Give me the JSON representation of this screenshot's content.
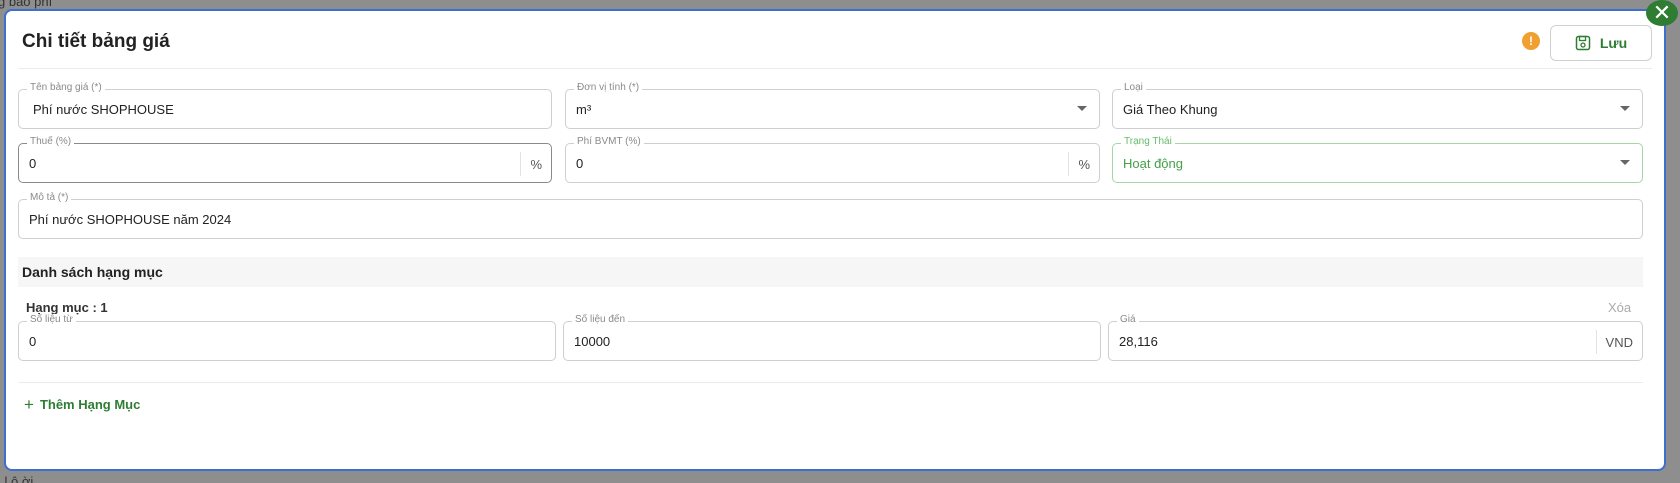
{
  "background": {
    "text_top": "g báo phí",
    "text_bottom": "i l ô ời"
  },
  "modal": {
    "title": "Chi tiết bảng giá",
    "close_icon": "close-icon",
    "info_icon": "info-icon",
    "save_label": "Lưu",
    "save_icon": "save-icon"
  },
  "fields": {
    "ten_bang_gia": {
      "label": "Tên bảng giá (*)",
      "value": "Phí nước SHOPHOUSE"
    },
    "don_vi_tinh": {
      "label": "Đơn vị tính (*)",
      "value": "m³"
    },
    "loai": {
      "label": "Loại",
      "value": "Giá Theo Khung"
    },
    "thue": {
      "label": "Thuế (%)",
      "value": "0",
      "suffix": "%"
    },
    "phi_bvmt": {
      "label": "Phí BVMT (%)",
      "value": "0",
      "suffix": "%"
    },
    "trang_thai": {
      "label": "Trạng Thái",
      "value": "Hoạt động"
    },
    "mo_ta": {
      "label": "Mô tả (*)",
      "value": "Phí nước SHOPHOUSE năm 2024"
    }
  },
  "section": {
    "title": "Danh sách hạng mục"
  },
  "item": {
    "title": "Hạng mục : 1",
    "delete_label": "Xóa",
    "so_lieu_tu": {
      "label": "Số liệu từ",
      "value": "0"
    },
    "so_lieu_den": {
      "label": "Số liệu đến",
      "value": "10000"
    },
    "gia": {
      "label": "Giá",
      "value": "28,116",
      "suffix": "VND"
    }
  },
  "add_item_label": "Thêm Hạng Mục",
  "colors": {
    "accent": "#2e7d32",
    "border_focus": "#3b6fd0",
    "info": "#f0a030"
  }
}
